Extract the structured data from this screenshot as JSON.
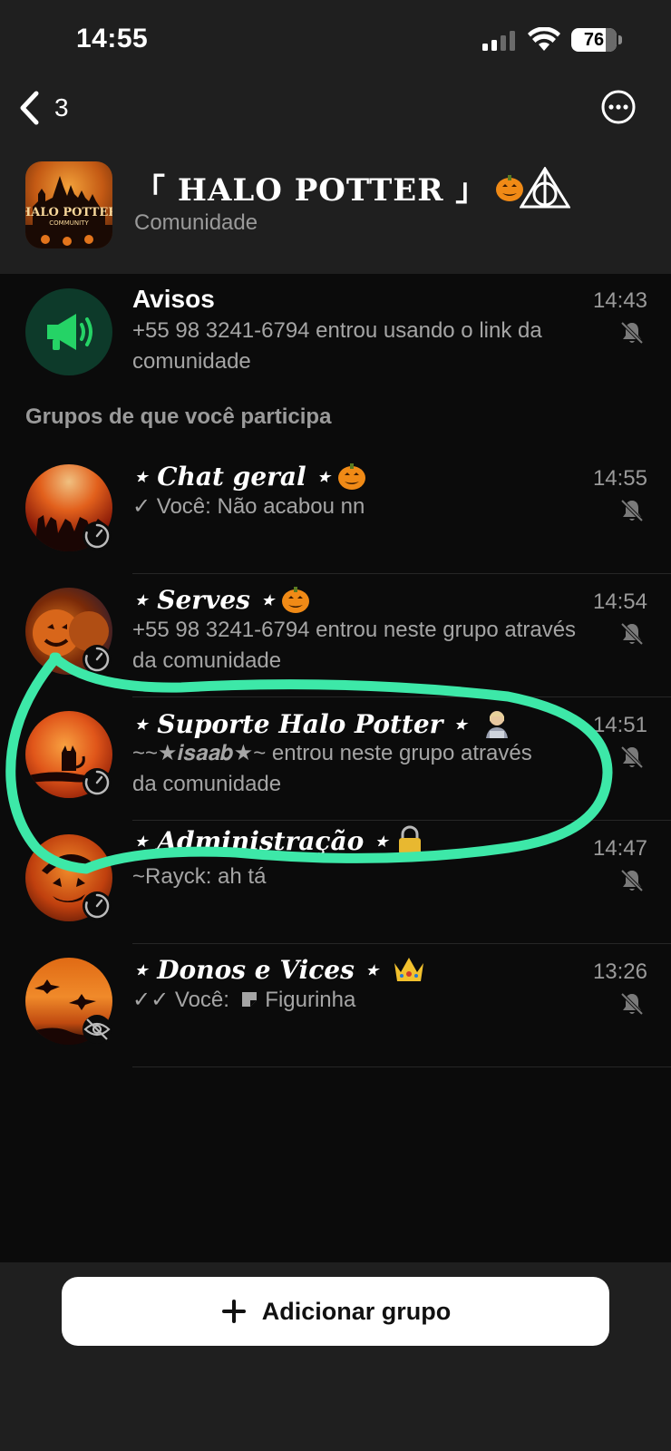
{
  "status_bar": {
    "time": "14:55",
    "battery": "76",
    "battery_level": 0.76
  },
  "nav": {
    "back_count": "3"
  },
  "community": {
    "title": "「 HALO POTTER 」",
    "subtitle": "Comunidade",
    "logo_text_1": "HALO POTTER",
    "logo_text_2": "COMMUNITY"
  },
  "announcements": {
    "name": "Avisos",
    "time": "14:43",
    "preview": "+55 98 3241-6794 entrou usando o link da comunidade"
  },
  "section_label": "Grupos de que você participa",
  "groups": [
    {
      "name": "⋆ Chat geral ⋆",
      "time": "14:55",
      "preview_sender": "✓ Você:",
      "preview_text": " Não acabou nn",
      "badge": "timer"
    },
    {
      "name": "⋆ Serves ⋆",
      "time": "14:54",
      "preview_sender": "",
      "preview_text": "+55 98 3241-6794 entrou neste grupo através da comunidade",
      "badge": "timer"
    },
    {
      "name": "⋆ Suporte Halo Potter ⋆",
      "time": "14:51",
      "preview_sender": "",
      "preview_text": "~~★𝒊𝒔𝒂𝒂𝒃★~ entrou neste grupo através da comunidade",
      "badge": "timer"
    },
    {
      "name": "⋆ Administração ⋆",
      "time": "14:47",
      "preview_sender": "",
      "preview_text": "~Rayck: ah tá",
      "badge": "timer"
    },
    {
      "name": "⋆ Donos e Vices ⋆",
      "time": "13:26",
      "preview_sender": "✓✓ Você:",
      "preview_text": " Figurinha",
      "badge": "hidden"
    }
  ],
  "add_group": {
    "label": "Adicionar grupo"
  },
  "colors": {
    "accent_green": "#25d366",
    "annotation": "#3de8a8",
    "background": "#0b0b0b",
    "header": "#1f1f1f"
  },
  "icons": [
    "signal-icon",
    "wifi-icon",
    "battery-icon",
    "back-chevron-icon",
    "more-icon",
    "megaphone-icon",
    "mute-icon",
    "timer-icon",
    "eye-off-icon",
    "plus-icon",
    "pumpkin-icon",
    "crown-icon",
    "lock-icon"
  ]
}
